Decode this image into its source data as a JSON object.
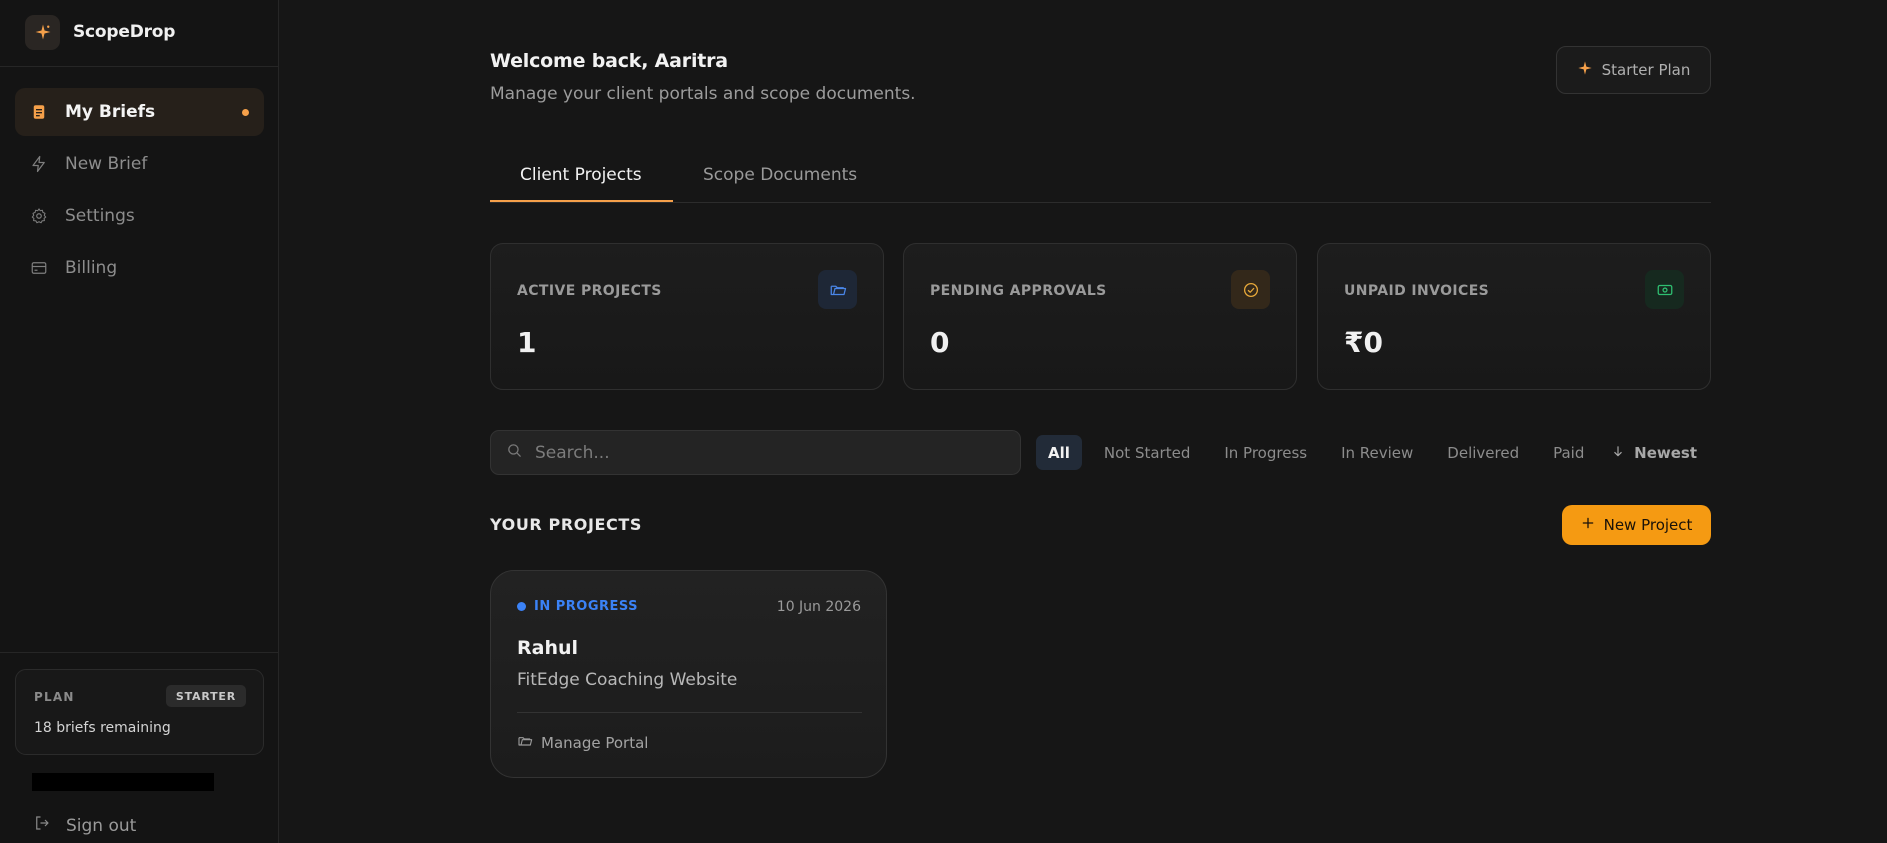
{
  "sidebar": {
    "brand": "ScopeDrop",
    "items": [
      {
        "label": "My Briefs",
        "icon": "document-icon",
        "active": true
      },
      {
        "label": "New Brief",
        "icon": "lightning-icon"
      },
      {
        "label": "Settings",
        "icon": "gear-icon"
      },
      {
        "label": "Billing",
        "icon": "credit-card-icon"
      }
    ],
    "plan": {
      "label": "PLAN",
      "badge": "STARTER",
      "remaining": "18 briefs remaining"
    },
    "signout": "Sign out"
  },
  "header": {
    "welcome": "Welcome back, Aaritra",
    "subtitle": "Manage your client portals and scope documents.",
    "plan_button": "Starter Plan"
  },
  "tabs": [
    {
      "label": "Client Projects",
      "active": true
    },
    {
      "label": "Scope Documents"
    }
  ],
  "stats": [
    {
      "label": "ACTIVE PROJECTS",
      "value": "1",
      "icon": "folder-icon",
      "color": "#4a86e8"
    },
    {
      "label": "PENDING APPROVALS",
      "value": "0",
      "icon": "check-circle-icon",
      "color": "#e8a93a"
    },
    {
      "label": "UNPAID INVOICES",
      "value": "₹0",
      "icon": "cash-icon",
      "color": "#2fbf71"
    }
  ],
  "search": {
    "placeholder": "Search..."
  },
  "filters": [
    "All",
    "Not Started",
    "In Progress",
    "In Review",
    "Delivered",
    "Paid"
  ],
  "sort_label": "Newest",
  "projects": {
    "title": "YOUR PROJECTS",
    "new_button": "New Project",
    "items": [
      {
        "status": "IN PROGRESS",
        "date": "10 Jun 2026",
        "client": "Rahul",
        "name": "FitEdge Coaching Website",
        "action": "Manage Portal"
      }
    ]
  },
  "colors": {
    "accent": "#f59a12",
    "status_in_progress": "#3b82f6"
  }
}
